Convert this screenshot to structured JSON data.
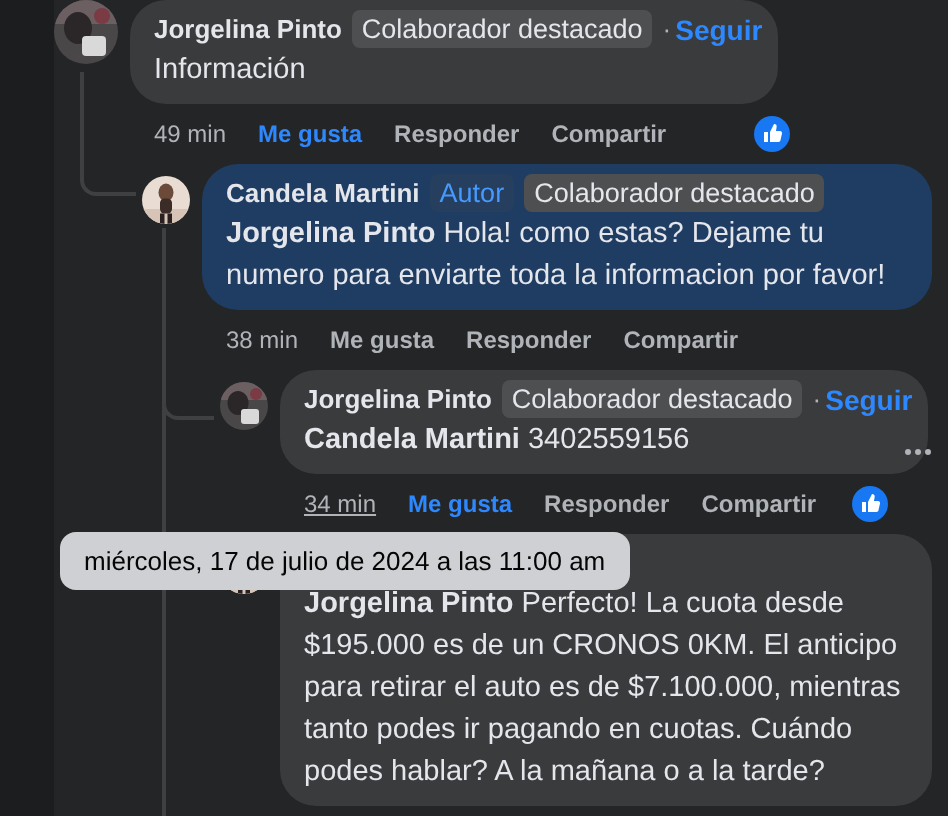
{
  "comments": [
    {
      "author": "Jorgelina Pinto",
      "badges": [
        {
          "label": "Colaborador destacado",
          "kind": "plain"
        }
      ],
      "separator": "·",
      "follow": "Seguir",
      "text": "Información",
      "actions": {
        "time": "49 min",
        "like": "Me gusta",
        "liked": true,
        "reply": "Responder",
        "share": "Compartir"
      },
      "reaction": true,
      "children": [
        {
          "author": "Candela Martini",
          "badges": [
            {
              "label": "Autor",
              "kind": "author"
            },
            {
              "label": "Colaborador destacado",
              "kind": "plain"
            }
          ],
          "text": "**Jorgelina Pinto** Hola! como estas? Dejame tu numero para enviarte toda la informacion por favor!",
          "highlighted": true,
          "actions": {
            "time": "38 min",
            "like": "Me gusta",
            "liked": false,
            "reply": "Responder",
            "share": "Compartir"
          },
          "children": [
            {
              "author": "Jorgelina Pinto",
              "badges": [
                {
                  "label": "Colaborador destacado",
                  "kind": "plain"
                }
              ],
              "separator": "·",
              "follow": "Seguir",
              "text": "**Candela Martini** 3402559156",
              "actions": {
                "time": "34 min",
                "time_hovered": true,
                "like": "Me gusta",
                "liked": true,
                "reply": "Responder",
                "share": "Compartir"
              },
              "reaction": true,
              "more_menu": true
            },
            {
              "text": "**Jorgelina Pinto** Perfecto! La cuota desde $195.000 es de un CRONOS 0KM. El anticipo para retirar el auto es de $7.100.000, mientras tanto podes ir pagando en cuotas. Cuándo podes hablar? A la mañana o a la tarde?"
            }
          ]
        }
      ]
    }
  ],
  "tooltip": {
    "text": "miércoles, 17 de julio de 2024 a las 11:00 am"
  }
}
